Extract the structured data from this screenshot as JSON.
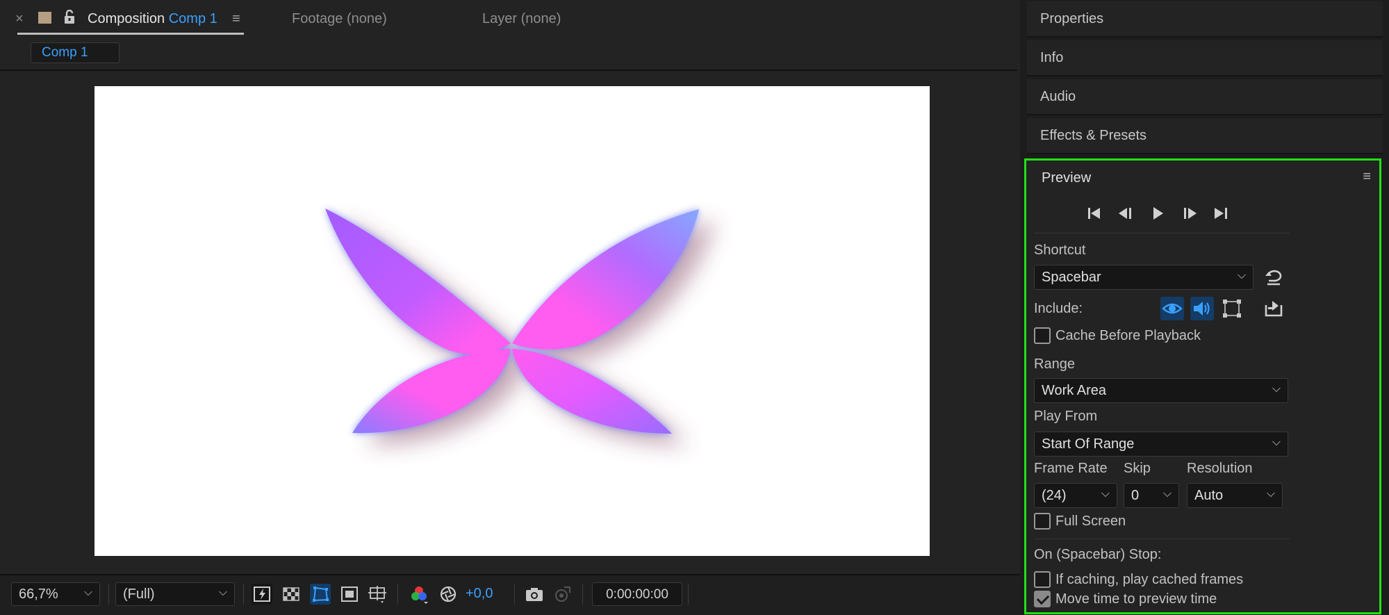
{
  "composition_panel": {
    "close_glyph": "×",
    "tab_prefix": "Composition",
    "tab_comp_name": "Comp 1",
    "menu_glyph": "≡",
    "footage_tab": "Footage (none)",
    "layer_tab": "Layer (none)",
    "sub_tab": "Comp 1"
  },
  "viewer_bar": {
    "zoom": "66,7%",
    "resolution": "(Full)",
    "exposure": "+0,0",
    "timecode": "0:00:00:00"
  },
  "right_panel": {
    "sections": [
      "Properties",
      "Info",
      "Audio",
      "Effects & Presets"
    ]
  },
  "preview": {
    "title": "Preview",
    "menu_glyph": "≡",
    "shortcut_label": "Shortcut",
    "shortcut_value": "Spacebar",
    "include_label": "Include:",
    "cache_before_playback": "Cache Before Playback",
    "range_label": "Range",
    "range_value": "Work Area",
    "play_from_label": "Play From",
    "play_from_value": "Start Of Range",
    "frame_rate_label": "Frame Rate",
    "frame_rate_value": "(24)",
    "skip_label": "Skip",
    "skip_value": "0",
    "resolution_label": "Resolution",
    "resolution_value": "Auto",
    "full_screen": "Full Screen",
    "on_stop_label": "On (Spacebar) Stop:",
    "if_caching": "If caching, play cached frames",
    "move_time": "Move time to preview time"
  },
  "colors": {
    "accent_blue": "#3aa0ff",
    "highlight_green": "#22e016",
    "butterfly_pink": "#ff5cf0",
    "butterfly_violet": "#a35cff"
  }
}
